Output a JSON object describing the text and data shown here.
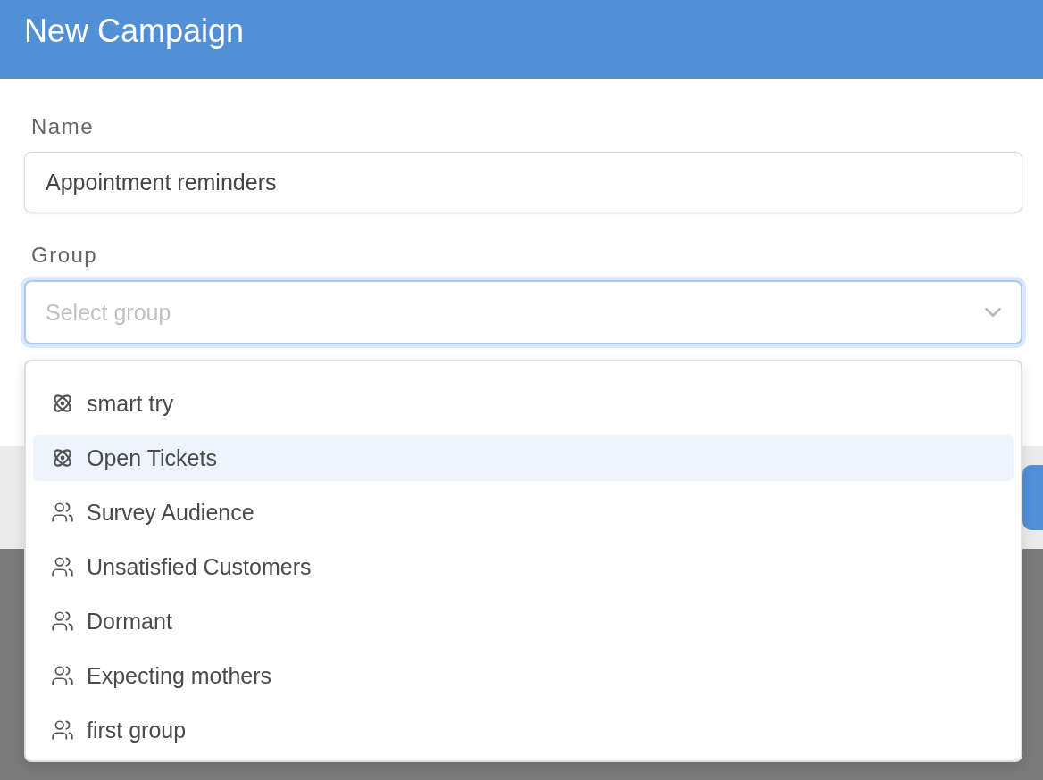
{
  "dialog": {
    "title": "New Campaign"
  },
  "fields": [
    {
      "label": "Name",
      "value": "Appointment reminders"
    },
    {
      "label": "Group",
      "placeholder": "Select group",
      "expanded": true
    }
  ],
  "dropdown": {
    "items": [
      {
        "label": "smart try",
        "kind": "smart",
        "selected": false
      },
      {
        "label": "Open Tickets",
        "kind": "smart",
        "selected": true
      },
      {
        "label": "Survey Audience",
        "kind": "static",
        "selected": false
      },
      {
        "label": "Unsatisfied Customers",
        "kind": "static",
        "selected": false
      },
      {
        "label": "Dormant",
        "kind": "static",
        "selected": false
      },
      {
        "label": "Expecting mothers",
        "kind": "static",
        "selected": false
      },
      {
        "label": "first group",
        "kind": "static",
        "selected": false
      }
    ]
  }
}
